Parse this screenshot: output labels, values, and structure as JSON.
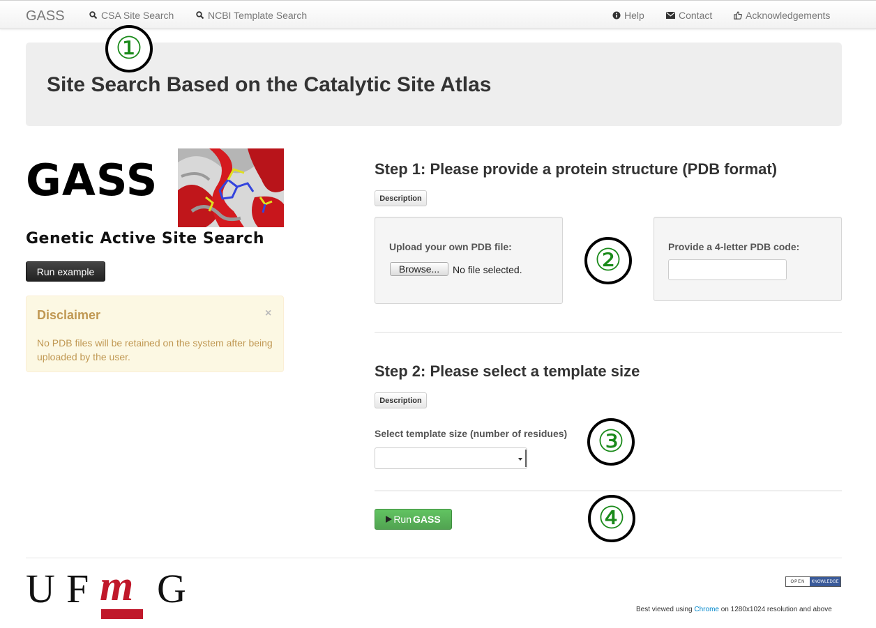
{
  "navbar": {
    "brand": "GASS",
    "left_items": [
      {
        "label": "CSA Site Search",
        "icon": "search-icon"
      },
      {
        "label": "NCBI Template Search",
        "icon": "search-icon"
      }
    ],
    "right_items": [
      {
        "label": "Help",
        "icon": "info-icon"
      },
      {
        "label": "Contact",
        "icon": "envelope-icon"
      },
      {
        "label": "Acknowledgements",
        "icon": "thumbs-up-icon"
      }
    ]
  },
  "hero": {
    "title": "Site Search Based on the Catalytic Site Atlas"
  },
  "markers": [
    "①",
    "②",
    "③",
    "④"
  ],
  "logo": {
    "word": "GASS",
    "subtitle": "Genetic Active Site Search"
  },
  "run_example_label": "Run example",
  "disclaimer": {
    "title": "Disclaimer",
    "close": "×",
    "text": "No PDB files will be retained on the system after being uploaded by the user."
  },
  "step1": {
    "title": "Step 1: Please provide a protein structure (PDB format)",
    "description_label": "Description",
    "upload_label": "Upload your own PDB file:",
    "browse_label": "Browse...",
    "file_status": "No file selected.",
    "code_label": "Provide a 4-letter PDB code:",
    "code_value": ""
  },
  "step2": {
    "title": "Step 2: Please select a template size",
    "description_label": "Description",
    "select_label": "Select template size (number of residues)",
    "select_value": ""
  },
  "run": {
    "prefix": "Run ",
    "bold": "GASS"
  },
  "footer": {
    "ufmg": [
      "U",
      "F",
      "m",
      "G"
    ],
    "badge_open": "OPEN",
    "badge_knowledge": "KNOWLEDGE",
    "best_view_prefix": "Best viewed using ",
    "best_view_link": "Chrome",
    "best_view_suffix": " on 1280x1024 resolution and above"
  },
  "colors": {
    "accent_green": "#51a351",
    "marker_green": "#1a8a1a",
    "alert_text": "#c09853",
    "ufmg_red": "#c0182a"
  }
}
